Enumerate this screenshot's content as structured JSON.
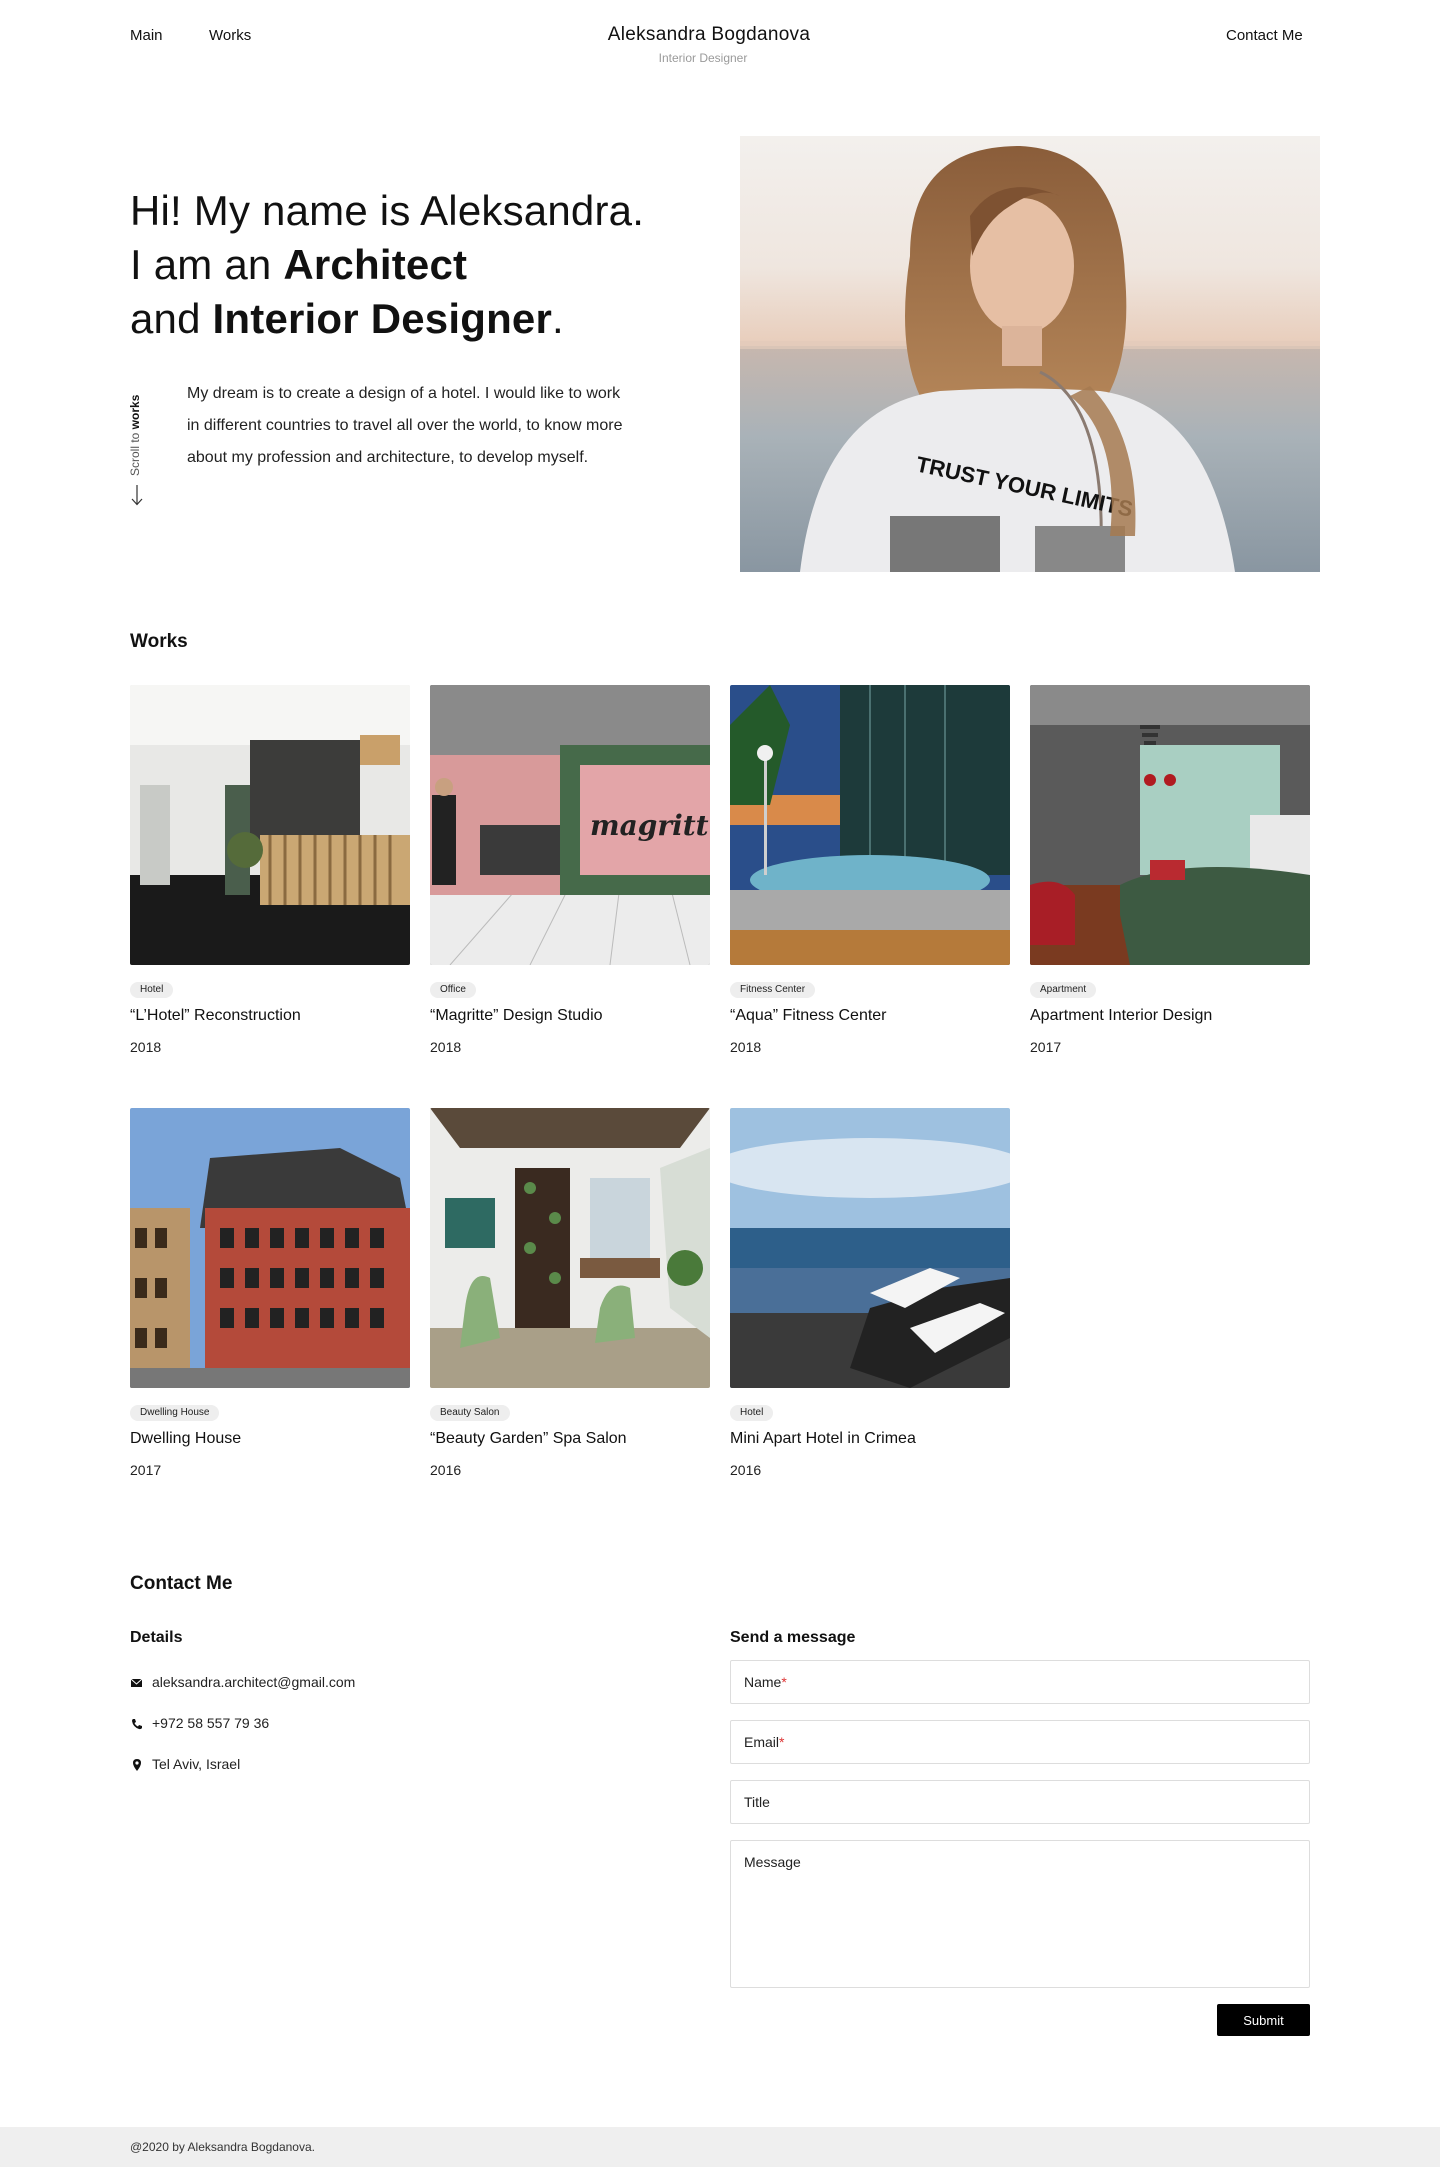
{
  "header": {
    "nav_main": "Main",
    "nav_works": "Works",
    "brand_name": "Aleksandra Bogdanova",
    "brand_sub": "Interior Designer",
    "nav_contact": "Contact Me"
  },
  "hero": {
    "line1": "Hi! My name is Aleksandra.",
    "line2_pre": "I am an ",
    "line2_bold": "Architect",
    "line3_pre": "and ",
    "line3_bold": "Interior Designer",
    "line3_post": ".",
    "scroll_pre": "Scroll to ",
    "scroll_bold": "works",
    "description": "My dream is to create a design of a hotel. I would like to work in different countries to travel all over the world, to know more about my profession and architecture, to develop myself.",
    "photo_shirt_text": "TRUST YOUR LIMITS"
  },
  "works": {
    "title": "Works",
    "items": [
      {
        "tag": "Hotel",
        "title": "“L’Hotel” Reconstruction",
        "year": "2018"
      },
      {
        "tag": "Office",
        "title": "“Magritte” Design Studio",
        "year": "2018",
        "image_text": "magritt"
      },
      {
        "tag": "Fitness Center",
        "title": "“Aqua” Fitness Center",
        "year": "2018"
      },
      {
        "tag": "Apartment",
        "title": "Apartment Interior Design",
        "year": "2017"
      },
      {
        "tag": "Dwelling House",
        "title": "Dwelling House",
        "year": "2017"
      },
      {
        "tag": "Beauty Salon",
        "title": "“Beauty Garden” Spa Salon",
        "year": "2016"
      },
      {
        "tag": "Hotel",
        "title": "Mini Apart Hotel in Crimea",
        "year": "2016"
      }
    ]
  },
  "contact": {
    "title": "Contact Me",
    "details_title": "Details",
    "email": "aleksandra.architect@gmail.com",
    "phone": "+972 58 557 79 36",
    "location": "Tel Aviv, Israel",
    "form_title": "Send a message",
    "name_label": "Name",
    "email_label": "Email",
    "required_mark": "*",
    "title_label": "Title",
    "message_label": "Message",
    "submit": "Submit"
  },
  "footer": {
    "text": "@2020 by Aleksandra Bogdanova."
  },
  "icons": {
    "email": "envelope-icon",
    "phone": "phone-icon",
    "location": "map-pin-icon",
    "scroll": "arrow-down-icon"
  }
}
